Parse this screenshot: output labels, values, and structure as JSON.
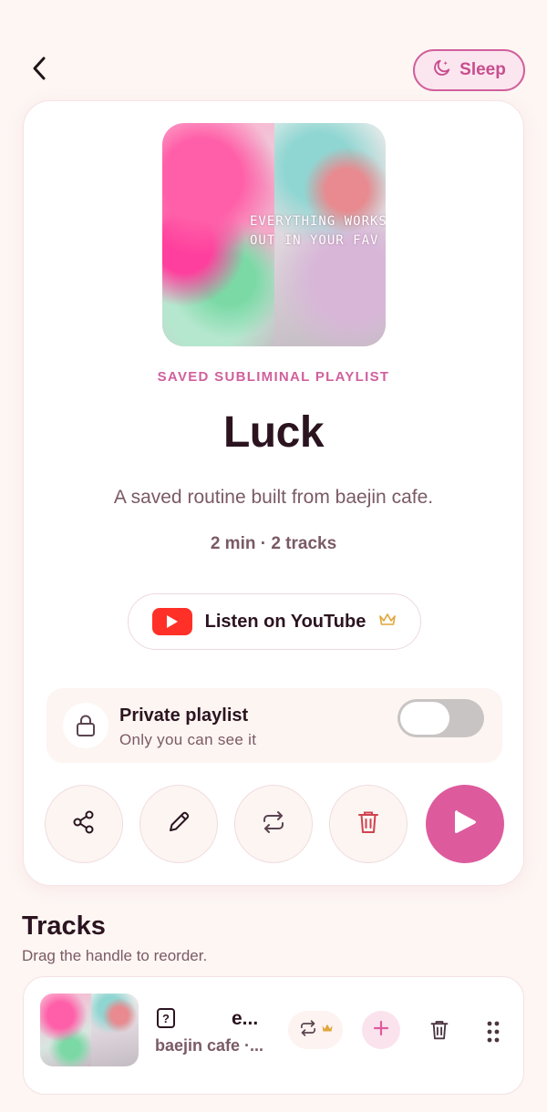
{
  "header": {
    "back_icon": "chevron-left-icon",
    "sleep_label": "Sleep",
    "sleep_icon": "moon-icon"
  },
  "playlist": {
    "cover_text_line1": "EVERYTHING WORKS",
    "cover_text_line2": "OUT IN YOUR FAV",
    "eyebrow": "SAVED SUBLIMINAL PLAYLIST",
    "title": "Luck",
    "description": "A saved routine built from baejin cafe.",
    "meta": "2 min · 2 tracks",
    "youtube_label": "Listen on YouTube",
    "youtube_icon": "youtube-play-icon",
    "premium_icon": "crown-icon"
  },
  "privacy": {
    "title": "Private playlist",
    "subtitle": "Only you can see it",
    "enabled": false
  },
  "actions": {
    "share_icon": "share-icon",
    "edit_icon": "pencil-icon",
    "repeat_icon": "repeat-icon",
    "delete_icon": "trash-icon",
    "play_icon": "play-icon"
  },
  "tracks": {
    "heading": "Tracks",
    "hint": "Drag the handle to reorder.",
    "items": [
      {
        "badge": "?",
        "name": "e...",
        "artist": "baejin cafe ·..."
      }
    ]
  },
  "colors": {
    "accent": "#dd5b9d",
    "accent_text": "#d0609c",
    "background": "#fdf6f3",
    "youtube_red": "#ff3028",
    "premium_gold": "#e0a63a"
  }
}
